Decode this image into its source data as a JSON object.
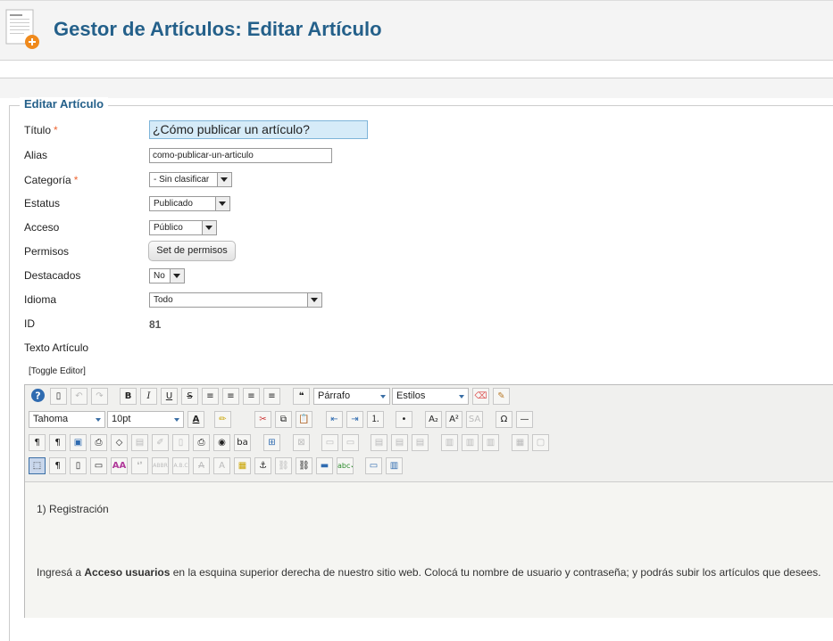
{
  "header": {
    "title": "Gestor de Artículos: Editar Artículo",
    "icon": "article-add-icon"
  },
  "form": {
    "legend": "Editar Artículo",
    "fields": {
      "title": {
        "label": "Título",
        "required": "*",
        "value": "¿Cómo publicar un artículo?"
      },
      "alias": {
        "label": "Alias",
        "value": "como-publicar-un-articulo"
      },
      "category": {
        "label": "Categoría",
        "required": "*",
        "value": "- Sin clasificar"
      },
      "status": {
        "label": "Estatus",
        "value": "Publicado"
      },
      "access": {
        "label": "Acceso",
        "value": "Público"
      },
      "permissions": {
        "label": "Permisos",
        "button": "Set de permisos"
      },
      "featured": {
        "label": "Destacados",
        "value": "No"
      },
      "language": {
        "label": "Idioma",
        "value": "Todo"
      },
      "id": {
        "label": "ID",
        "value": "81"
      },
      "text": {
        "label": "Texto Artículo"
      }
    },
    "toggle_editor": "[Toggle Editor]"
  },
  "editor": {
    "format_select": "Párrafo",
    "styles_select": "Estilos",
    "font_select": "Tahoma",
    "size_select": "10pt",
    "content": {
      "p1": "1) Registración",
      "p2_before": "Ingresá a ",
      "p2_bold": "Acceso usuarios",
      "p2_after": " en la esquina superior derecha de nuestro sitio web. Colocá tu nombre de usuario y contraseña; y podrás subir los artículos que desees."
    }
  }
}
